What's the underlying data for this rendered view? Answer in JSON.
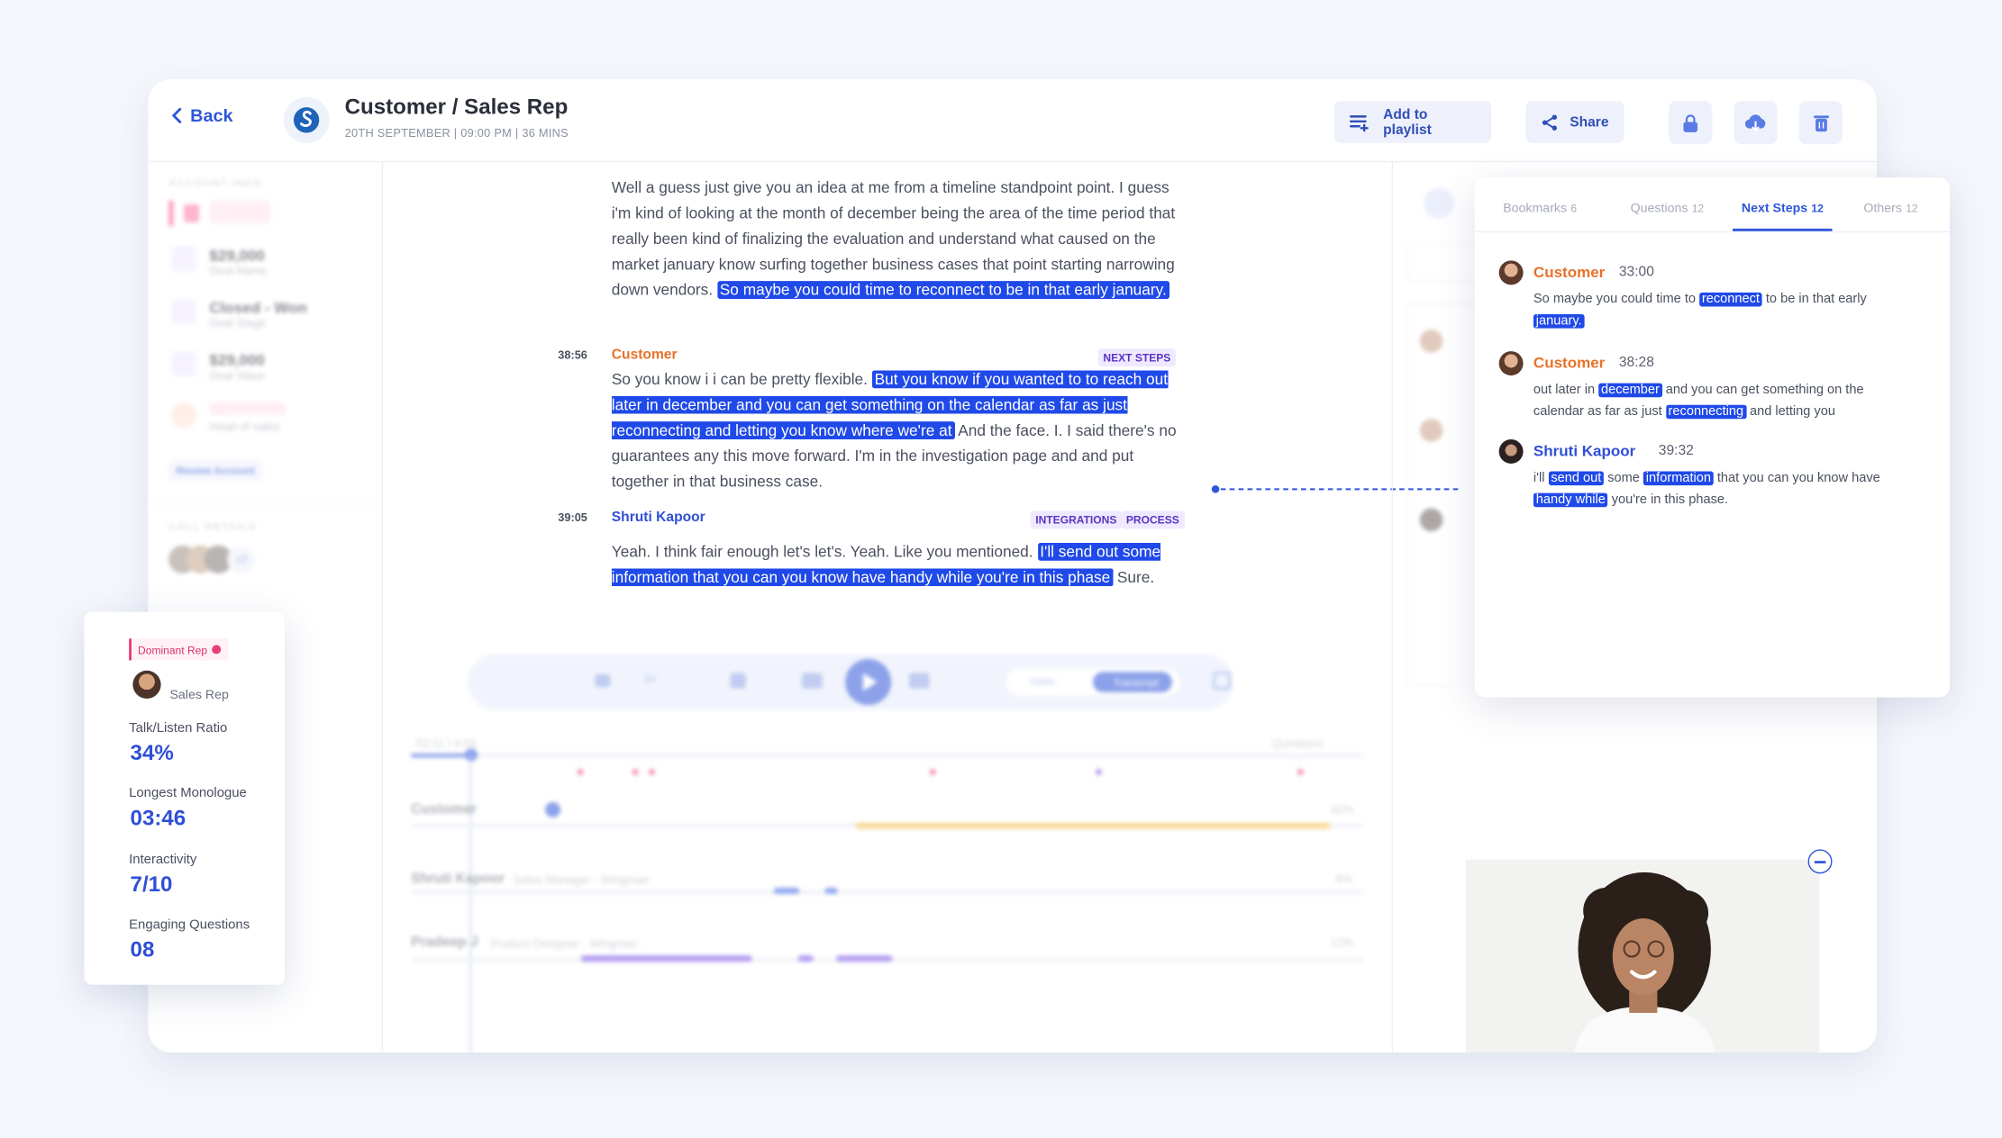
{
  "header": {
    "back_label": "Back",
    "title": "Customer / Sales Rep",
    "subtitle": "20TH SEPTEMBER | 09:00 PM | 36 MINS",
    "add_playlist_label": "Add to playlist",
    "share_label": "Share"
  },
  "sidebar": {
    "account_info_label": "ACCOUNT INFO",
    "items": [
      {
        "value": "$29,000",
        "label": "Deal Name"
      },
      {
        "value": "Closed - Won",
        "label": "Deal Stage"
      },
      {
        "value": "$29,000",
        "label": "Deal Value"
      },
      {
        "value": "",
        "label": "Head of sales"
      }
    ],
    "review_account_label": "Review Account",
    "call_details_label": "CALL DETAILS",
    "participants_more": "+7"
  },
  "transcript": {
    "block1": {
      "plain": "Well a guess just give you an idea at me from a timeline standpoint point. I guess i'm kind of looking at the month of december being the area of the time period that really been kind of finalizing the evaluation and understand what caused on the market january know surfing together business cases that point starting narrowing down vendors.",
      "highlight": "So maybe you could time to reconnect to be in that early january."
    },
    "block2": {
      "time": "38:56",
      "speaker": "Customer",
      "tag": "NEXT STEPS",
      "pre": "So you know i i can be pretty flexible.",
      "highlight": "But you know if you wanted to to reach out later in december and you can get something on the calendar as far as just reconnecting and letting you know where we're at",
      "post": "And the face. I. I said there's no guarantees any this move forward. I'm in the investigation page and and put together in that business case."
    },
    "block3": {
      "time": "39:05",
      "speaker": "Shruti Kapoor",
      "tags": [
        "INTEGRATIONS",
        "PROCESS"
      ],
      "pre": "Yeah. I think fair enough let's let's. Yeah. Like you mentioned.",
      "highlight": "I'll send out some information that you can you know have handy while you're in this phase",
      "post": "Sure."
    }
  },
  "player": {
    "speed": "1x",
    "video_label": "Video",
    "transcript_label": "Transcript",
    "time": "02:11 / 4:03",
    "questions_label": "Questions",
    "tracks": [
      {
        "name": "Customer",
        "role": "",
        "pct": "42%"
      },
      {
        "name": "Shruti Kapoor",
        "role": "Sales Manager - Wingman",
        "pct": "6%"
      },
      {
        "name": "Pradeep J",
        "role": "Product Designer - Wingman",
        "pct": "12%"
      }
    ]
  },
  "stats": {
    "badge": "Dominant Rep",
    "rep_label": "Sales Rep",
    "items": [
      {
        "label": "Talk/Listen Ratio",
        "value": "34%"
      },
      {
        "label": "Longest Monologue",
        "value": "03:46"
      },
      {
        "label": "Interactivity",
        "value": "7/10"
      },
      {
        "label": "Engaging Questions",
        "value": "08"
      }
    ]
  },
  "next_steps_panel": {
    "tabs": [
      {
        "label": "Bookmarks",
        "count": "6"
      },
      {
        "label": "Questions",
        "count": "12"
      },
      {
        "label": "Next Steps",
        "count": "12"
      },
      {
        "label": "Others",
        "count": "12"
      }
    ],
    "entries": [
      {
        "speaker": "Customer",
        "time": "33:00"
      },
      {
        "speaker": "Customer",
        "time": "38:28"
      },
      {
        "speaker": "Shruti Kapoor",
        "time": "39:32"
      }
    ],
    "e1": {
      "a": "So maybe you could time to ",
      "h1": "reconnect",
      "b": " to be in that early ",
      "h2": "january."
    },
    "e2": {
      "a": "out later in ",
      "h1": "december",
      "b": " and you can get something on the calendar as far as just ",
      "h2": "reconnecting",
      "c": " and letting you"
    },
    "e3": {
      "a": "i'll ",
      "h1": "send out",
      "b": " some ",
      "h2": "information",
      "c": " that you can you know have ",
      "h3": "handy while",
      "d": " you're in this phase."
    }
  },
  "colors": {
    "accent": "#2f56d9",
    "highlight": "#1f49e8",
    "customer": "#e8722a",
    "tag_bg": "#efe9ff",
    "talk_bar_customer": "#f3bf4b",
    "talk_bar_blue": "#3a65e0",
    "talk_bar_purple": "#7b4fe6"
  }
}
